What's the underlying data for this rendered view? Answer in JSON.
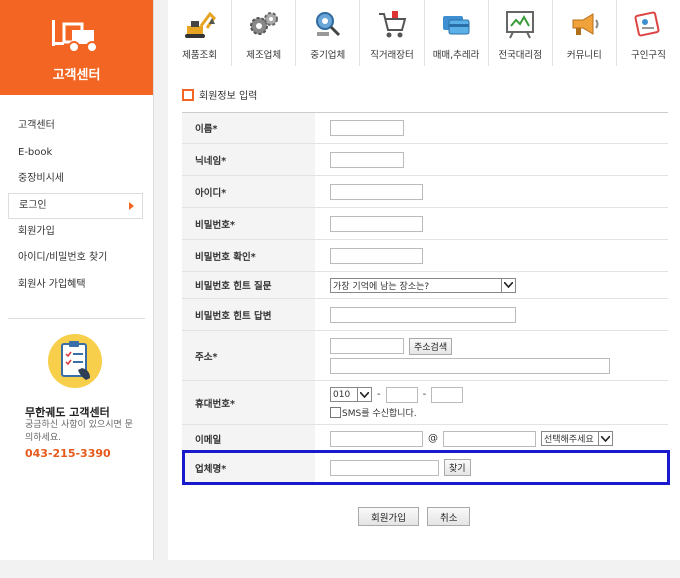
{
  "sidebar": {
    "title": "고객센터",
    "items": [
      {
        "label": "고객센터",
        "active": false
      },
      {
        "label": "E-book",
        "active": false
      },
      {
        "label": "중장비시세",
        "active": false
      },
      {
        "label": "로그인",
        "active": true
      },
      {
        "label": "회원가입",
        "active": false
      },
      {
        "label": "아이디/비밀번호 찾기",
        "active": false
      },
      {
        "label": "회원사 가입혜택",
        "active": false
      }
    ],
    "cs_title": "무한궤도 고객센터",
    "cs_desc": "궁금하신 사항이 있으시면 문의하세요.",
    "cs_phone": "043-215-3390"
  },
  "nav": [
    {
      "label": "제품조회",
      "icon": "excavator-icon"
    },
    {
      "label": "제조업체",
      "icon": "gears-icon"
    },
    {
      "label": "중기업체",
      "icon": "gear-search-icon"
    },
    {
      "label": "직거래장터",
      "icon": "cart-icon"
    },
    {
      "label": "매매,추레라",
      "icon": "cards-icon"
    },
    {
      "label": "전국대리점",
      "icon": "map-board-icon"
    },
    {
      "label": "커뮤니티",
      "icon": "megaphone-icon"
    },
    {
      "label": "구인구직",
      "icon": "id-card-icon"
    }
  ],
  "form": {
    "section_title": "회원정보 입력",
    "labels": {
      "name": "이름*",
      "nickname": "닉네임*",
      "userid": "아이디*",
      "password": "비밀번호*",
      "password_confirm": "비밀번호 확인*",
      "hint_q": "비밀번호 힌트 질문",
      "hint_a": "비밀번호 힌트 답변",
      "address": "주소*",
      "mobile": "휴대번호*",
      "email": "이메일",
      "company": "업체명*"
    },
    "hint_q_selected": "가장 기억에 남는 장소는?",
    "address_search_btn": "주소검색",
    "mobile_prefix": "010",
    "dash": "-",
    "sms_label": "SMS를 수신합니다.",
    "at": "@",
    "email_domain_selected": "선택해주세요",
    "find_btn": "찾기",
    "submit_btn": "회원가입",
    "cancel_btn": "취소"
  },
  "colors": {
    "brand": "#f26522",
    "highlight": "#1a1acd"
  }
}
